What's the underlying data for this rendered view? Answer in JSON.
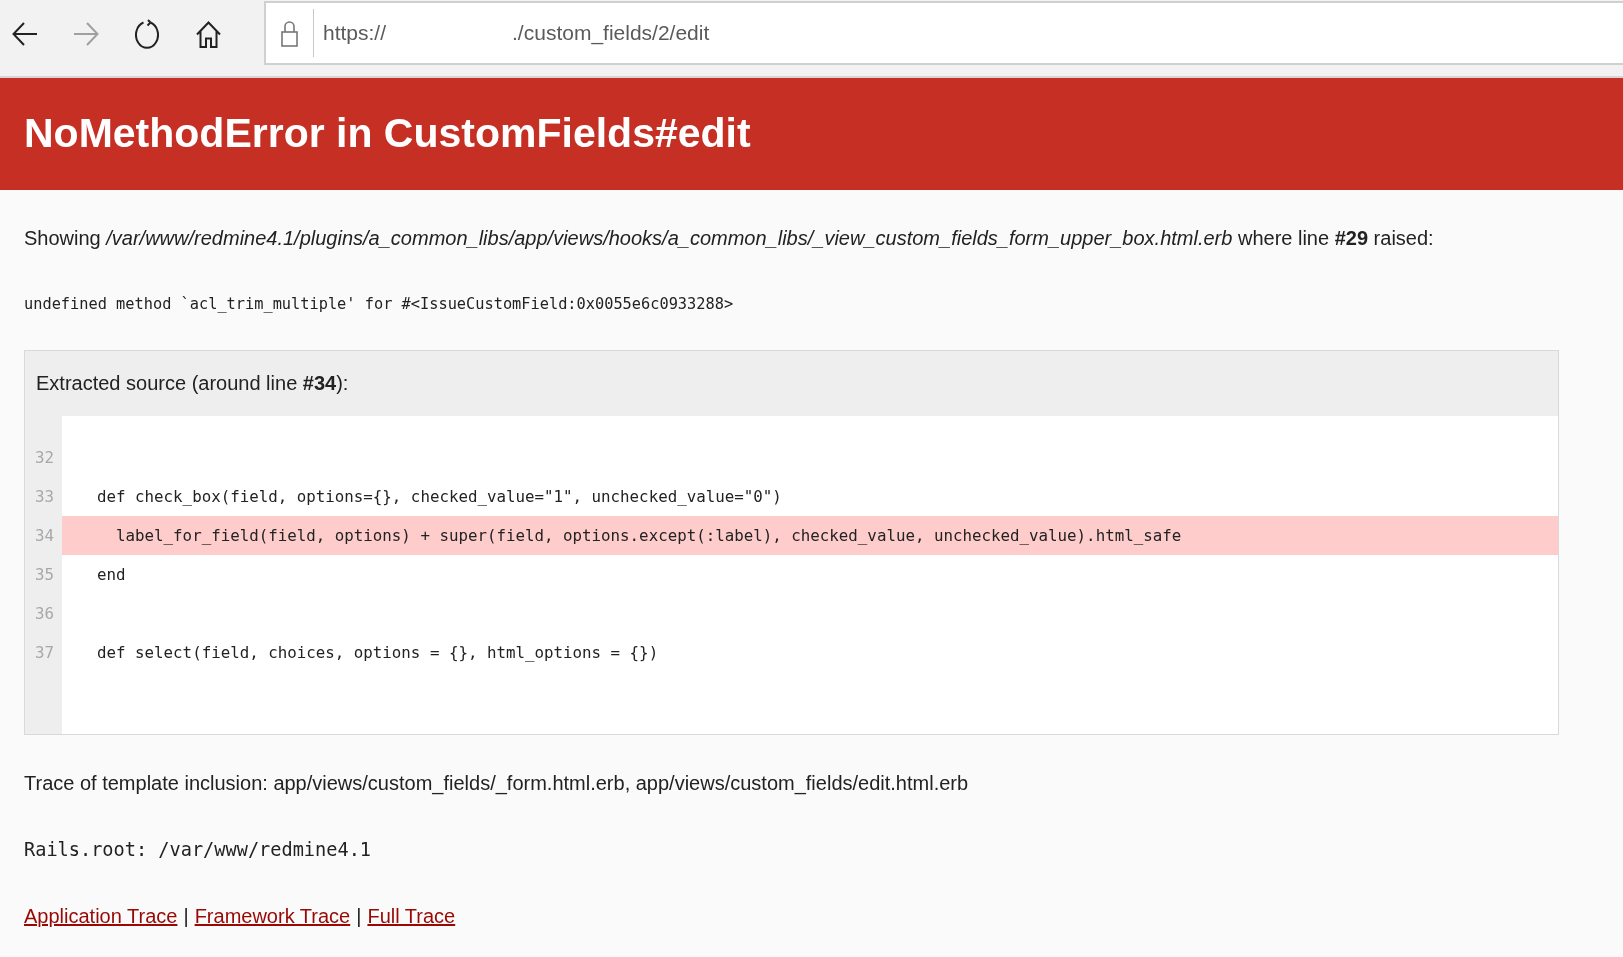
{
  "browser": {
    "nav_buttons": [
      {
        "kind": "back",
        "disabled": false
      },
      {
        "kind": "forward",
        "disabled": true
      },
      {
        "kind": "reload",
        "disabled": false
      },
      {
        "kind": "home",
        "disabled": false
      }
    ],
    "address_bar": {
      "url_parts": [
        "https://",
        "./custom_fields/2/edit"
      ]
    }
  },
  "error_page": {
    "title": "NoMethodError in CustomFields#edit",
    "template_message": "Showing */var/www/redmine4.1/plugins/a_common_libs/app/views/hooks/a_common_libs/_view_custom_fields_form_upper_box.html.erb* where line **#29** raised:",
    "error_message": "undefined method `acl_trim_multiple' for #<IssueCustomField:0x0055e6c0933288>",
    "source": {
      "title": "Extracted source (around line **#34**):",
      "lines": [
        {
          "number": "32",
          "highlighted": false
        },
        {
          "number": "33",
          "code": "  def check_box(field, options={}, checked_value=\"1\", unchecked_value=\"0\")",
          "highlighted": false
        },
        {
          "number": "34",
          "code": "    label_for_field(field, options) + super(field, options.except(:label), checked_value, unchecked_value).html_safe",
          "highlighted": true
        },
        {
          "number": "35",
          "code": "  end",
          "highlighted": false
        },
        {
          "number": "36",
          "highlighted": false
        },
        {
          "number": "37",
          "code": "  def select(field, choices, options = {}, html_options = {})",
          "highlighted": false
        }
      ]
    },
    "template_trace": "Trace of template inclusion: app/views/custom_fields/_form.html.erb, app/views/custom_fields/edit.html.erb",
    "rails_root": "Rails.root: /var/www/redmine4.1",
    "trace_links": [
      {
        "kind": "link",
        "text": "Application Trace"
      },
      {
        "kind": "separator",
        "text": "|"
      },
      {
        "kind": "link",
        "text": "Framework Trace"
      },
      {
        "kind": "separator",
        "text": "|"
      },
      {
        "kind": "link",
        "text": "Full Trace"
      }
    ]
  }
}
